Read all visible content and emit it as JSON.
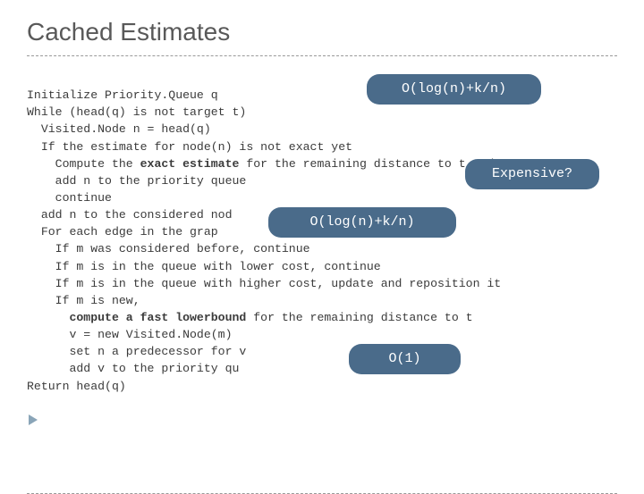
{
  "title": "Cached Estimates",
  "code": {
    "l1": "Initialize Priority.Queue q",
    "l2": "While (head(q) is not target t)",
    "l3": "  Visited.Node n = head(q)",
    "l4": "  If the estimate for node(n) is not exact yet",
    "l5a": "    Compute the ",
    "l5b": "exact estimate",
    "l5c": " for the remaining distance to t and",
    "l6": "    add n to the priority queue",
    "l7": "    continue",
    "l8": "  add n to the considered nod",
    "l9": "  For each edge in the grap",
    "l10": "    If m was considered before, continue",
    "l11": "    If m is in the queue with lower cost, continue",
    "l12": "    If m is in the queue with higher cost, update and reposition it",
    "l13": "    If m is new,",
    "l14a": "      compute a fast lowerbound",
    "l14b": " for the remaining distance to t",
    "l15": "      v = new Visited.Node(m)",
    "l16": "      set n a predecessor for v",
    "l17": "      add v to the priority qu",
    "l18": "Return head(q)"
  },
  "bubbles": {
    "b1": "O(log(n)+k/n)",
    "b2": "Expensive?",
    "b3": "O(log(n)+k/n)",
    "b4": "O(1)"
  }
}
